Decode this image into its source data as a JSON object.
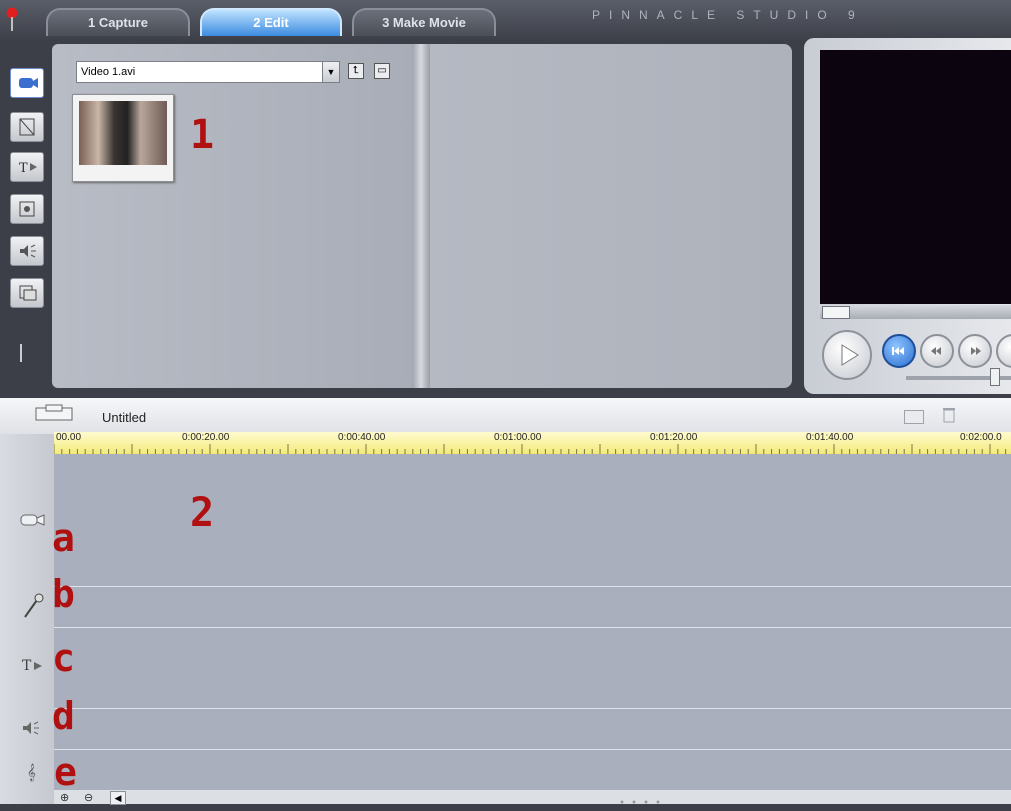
{
  "app": {
    "brand": "PINNACLE STUDIO 9"
  },
  "tabs": [
    {
      "label": "1 Capture",
      "active": false
    },
    {
      "label": "2 Edit",
      "active": true
    },
    {
      "label": "3 Make Movie",
      "active": false
    }
  ],
  "album": {
    "dropdown_value": "Video 1.avi",
    "annotation": "1",
    "left_tools": [
      "video-icon",
      "transition-icon",
      "title-icon",
      "photo-icon",
      "sound-effect-icon",
      "menu-icon"
    ]
  },
  "timeline": {
    "title": "Untitled",
    "ruler": [
      "00.00",
      "0:00:20.00",
      "0:00:40.00",
      "0:01:00.00",
      "0:01:20.00",
      "0:01:40.00",
      "0:02:00.0"
    ],
    "annotation": "2",
    "track_labels": [
      "a",
      "b",
      "c",
      "d",
      "e"
    ],
    "track_icons": [
      "video-track-icon",
      "voiceover-mic-icon",
      "title-track-icon",
      "sound-track-icon",
      "music-track-icon"
    ]
  },
  "colors": {
    "annotation": "#b11010",
    "active_tab": "#3b8be0",
    "ruler": "#f3ea7a"
  }
}
